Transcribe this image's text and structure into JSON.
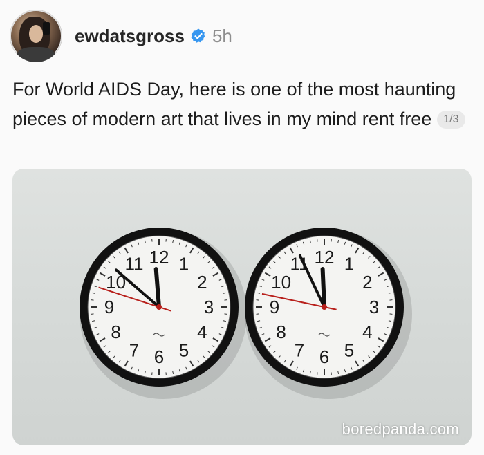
{
  "post": {
    "username": "ewdatsgross",
    "time_ago": "5h",
    "caption": "For World AIDS Day, here is one of the most haunting pieces of modern art that lives in my mind rent free",
    "page_indicator": "1/3",
    "icons": {
      "avatar": "profile-photo",
      "verified": "verified-badge-icon"
    },
    "colors": {
      "verified": "#3797f0",
      "time": "#8e8e8e"
    }
  },
  "image": {
    "clock_numerals": [
      "12",
      "1",
      "2",
      "3",
      "4",
      "5",
      "6",
      "7",
      "8",
      "9",
      "10",
      "11"
    ],
    "clocks": [
      {
        "hour": 11,
        "minute": 51,
        "second": 48
      },
      {
        "hour": 11,
        "minute": 55,
        "second": 47
      }
    ],
    "watermark": "boredpanda.com"
  }
}
